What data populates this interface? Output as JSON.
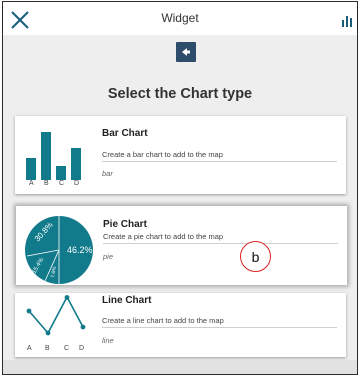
{
  "window": {
    "title": "Widget",
    "close_icon": "close-icon",
    "chart_icon": "bar-chart-icon",
    "back_icon": "arrow-left-icon"
  },
  "heading": "Select the Chart type",
  "colors": {
    "teal": "#117a8b",
    "back_button": "#2e4d6b",
    "marker_border": "#dd2222"
  },
  "cards": [
    {
      "title": "Bar Chart",
      "description": "Create a bar chart to add to the map",
      "code": "bar",
      "axis_labels": [
        "A",
        "B",
        "C",
        "D"
      ]
    },
    {
      "title": "Pie Chart",
      "description": "Create a pie chart to add to the map",
      "code": "pie",
      "slice_labels": [
        "30.8%",
        "46.2%",
        "15.4%",
        "7.6%"
      ]
    },
    {
      "title": "Line Chart",
      "description": "Create a line chart to add to the map",
      "code": "line",
      "axis_labels": [
        "A",
        "B",
        "C",
        "D"
      ]
    }
  ],
  "marker": "b"
}
